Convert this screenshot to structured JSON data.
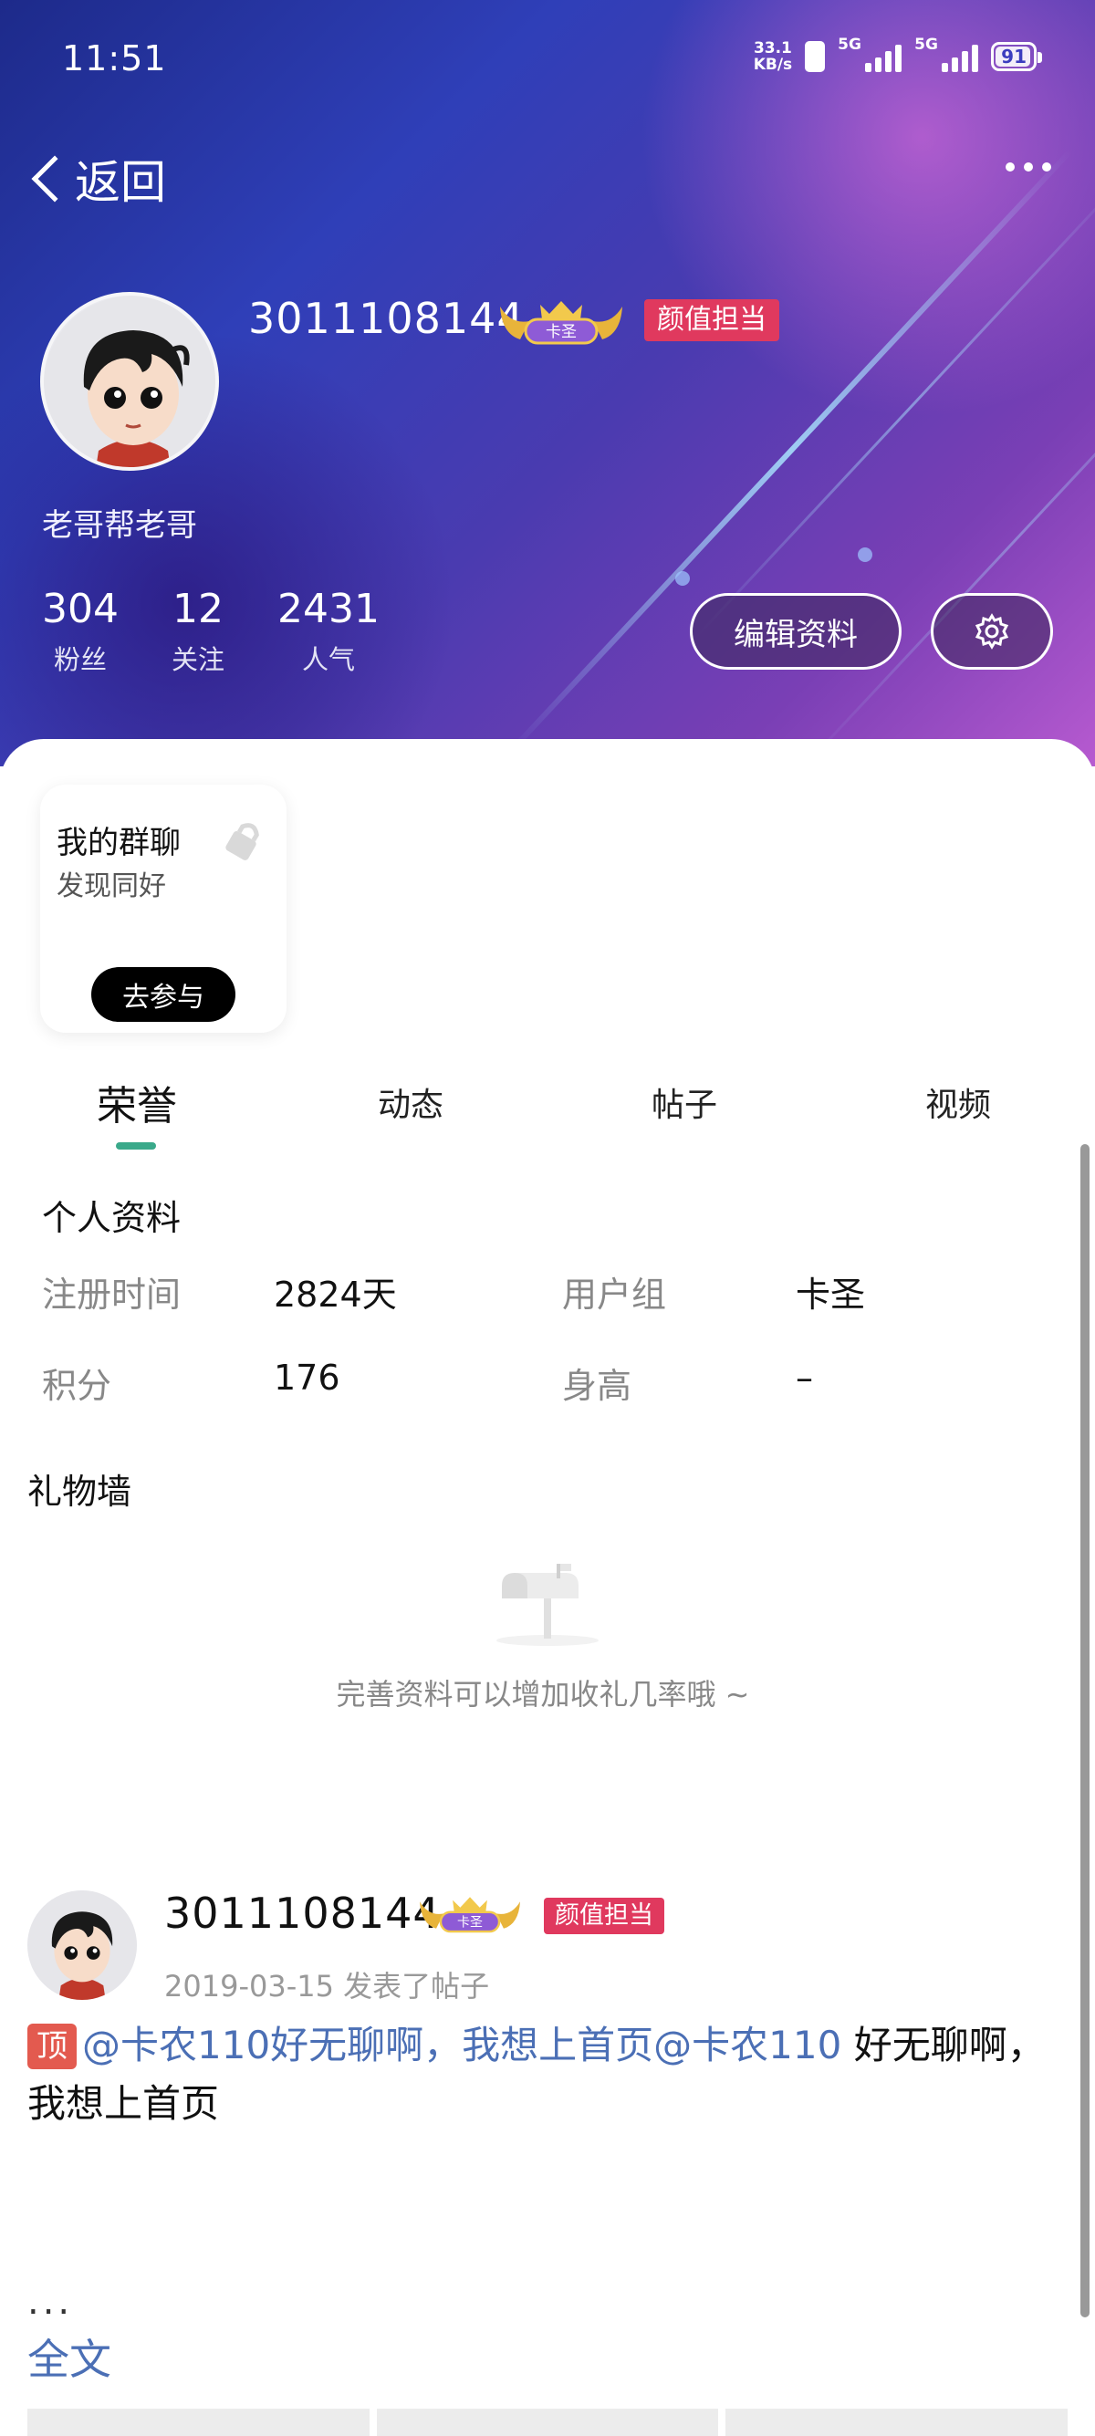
{
  "status_bar": {
    "time": "11:51",
    "net_speed_value": "33.1",
    "net_speed_unit": "KB/s",
    "sim1_label": "5G",
    "sim2_label": "5G",
    "battery": "91"
  },
  "nav": {
    "back_label": "返回"
  },
  "profile": {
    "username": "3011108144",
    "rank_badge_text": "卡圣",
    "tag": "颜值担当",
    "signature": "老哥帮老哥",
    "stats": [
      {
        "value": "304",
        "label": "粉丝"
      },
      {
        "value": "12",
        "label": "关注"
      },
      {
        "value": "2431",
        "label": "人气"
      }
    ],
    "edit_button": "编辑资料"
  },
  "group_card": {
    "title": "我的群聊",
    "subtitle": "发现同好",
    "join_button": "去参与"
  },
  "tabs": [
    "荣誉",
    "动态",
    "帖子",
    "视频"
  ],
  "personal_info": {
    "title": "个人资料",
    "rows": [
      {
        "key1": "注册时间",
        "val1": "2824天",
        "key2": "用户组",
        "val2": "卡圣"
      },
      {
        "key1": "积分",
        "val1": "176",
        "key2": "身高",
        "val2": "–"
      }
    ]
  },
  "gift_wall": {
    "title": "礼物墙",
    "empty_text": "完善资料可以增加收礼几率哦 ~"
  },
  "post": {
    "username": "3011108144",
    "rank_badge_text": "卡圣",
    "tag": "颜值担当",
    "meta": "2019-03-15  发表了帖子",
    "top_badge": "顶",
    "mention_part": "@卡农110好无聊啊，我想上首页@卡农110",
    "text_part": " 好无聊啊，我想上首页",
    "ellipsis": "...",
    "full_link": "全文"
  },
  "icons": {
    "back": "chevron-left-icon",
    "more": "more-dots-icon",
    "settings": "gear-icon",
    "lock": "lock-icon",
    "mailbox": "mailbox-icon"
  },
  "colors": {
    "tag_red": "#e0395e",
    "tab_underline": "#3aa98a",
    "mention_blue": "#4b6fb5",
    "top_badge_red": "#e35a4f"
  }
}
